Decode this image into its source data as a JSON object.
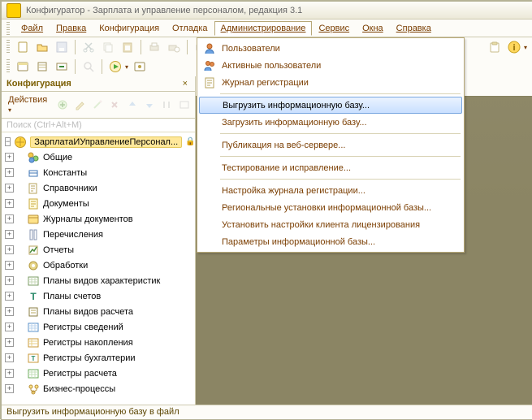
{
  "title": "Конфигуратор - Зарплата и управление персоналом, редакция 3.1",
  "menu": {
    "file": "Файл",
    "edit": "Правка",
    "config": "Конфигурация",
    "debug": "Отладка",
    "admin": "Администрирование",
    "service": "Сервис",
    "windows": "Окна",
    "help": "Справка"
  },
  "panel": {
    "title": "Конфигурация",
    "actions_label": "Действия",
    "search_placeholder": "Поиск (Ctrl+Alt+M)"
  },
  "tree": {
    "root": "ЗарплатаИУправлениеПерсонал...",
    "items": [
      "Общие",
      "Константы",
      "Справочники",
      "Документы",
      "Журналы документов",
      "Перечисления",
      "Отчеты",
      "Обработки",
      "Планы видов характеристик",
      "Планы счетов",
      "Планы видов расчета",
      "Регистры сведений",
      "Регистры накопления",
      "Регистры бухгалтерии",
      "Регистры расчета",
      "Бизнес-процессы"
    ]
  },
  "dropdown": {
    "users": "Пользователи",
    "active_users": "Активные пользователи",
    "journal": "Журнал регистрации",
    "export_ib": "Выгрузить информационную базу...",
    "import_ib": "Загрузить информационную базу...",
    "publish": "Публикация на веб-сервере...",
    "test_fix": "Тестирование и исправление...",
    "journal_settings": "Настройка журнала регистрации...",
    "regional": "Региональные установки информационной базы...",
    "licensing": "Установить настройки клиента лицензирования",
    "params": "Параметры информационной базы..."
  },
  "status": "Выгрузить информационную базу в файл"
}
